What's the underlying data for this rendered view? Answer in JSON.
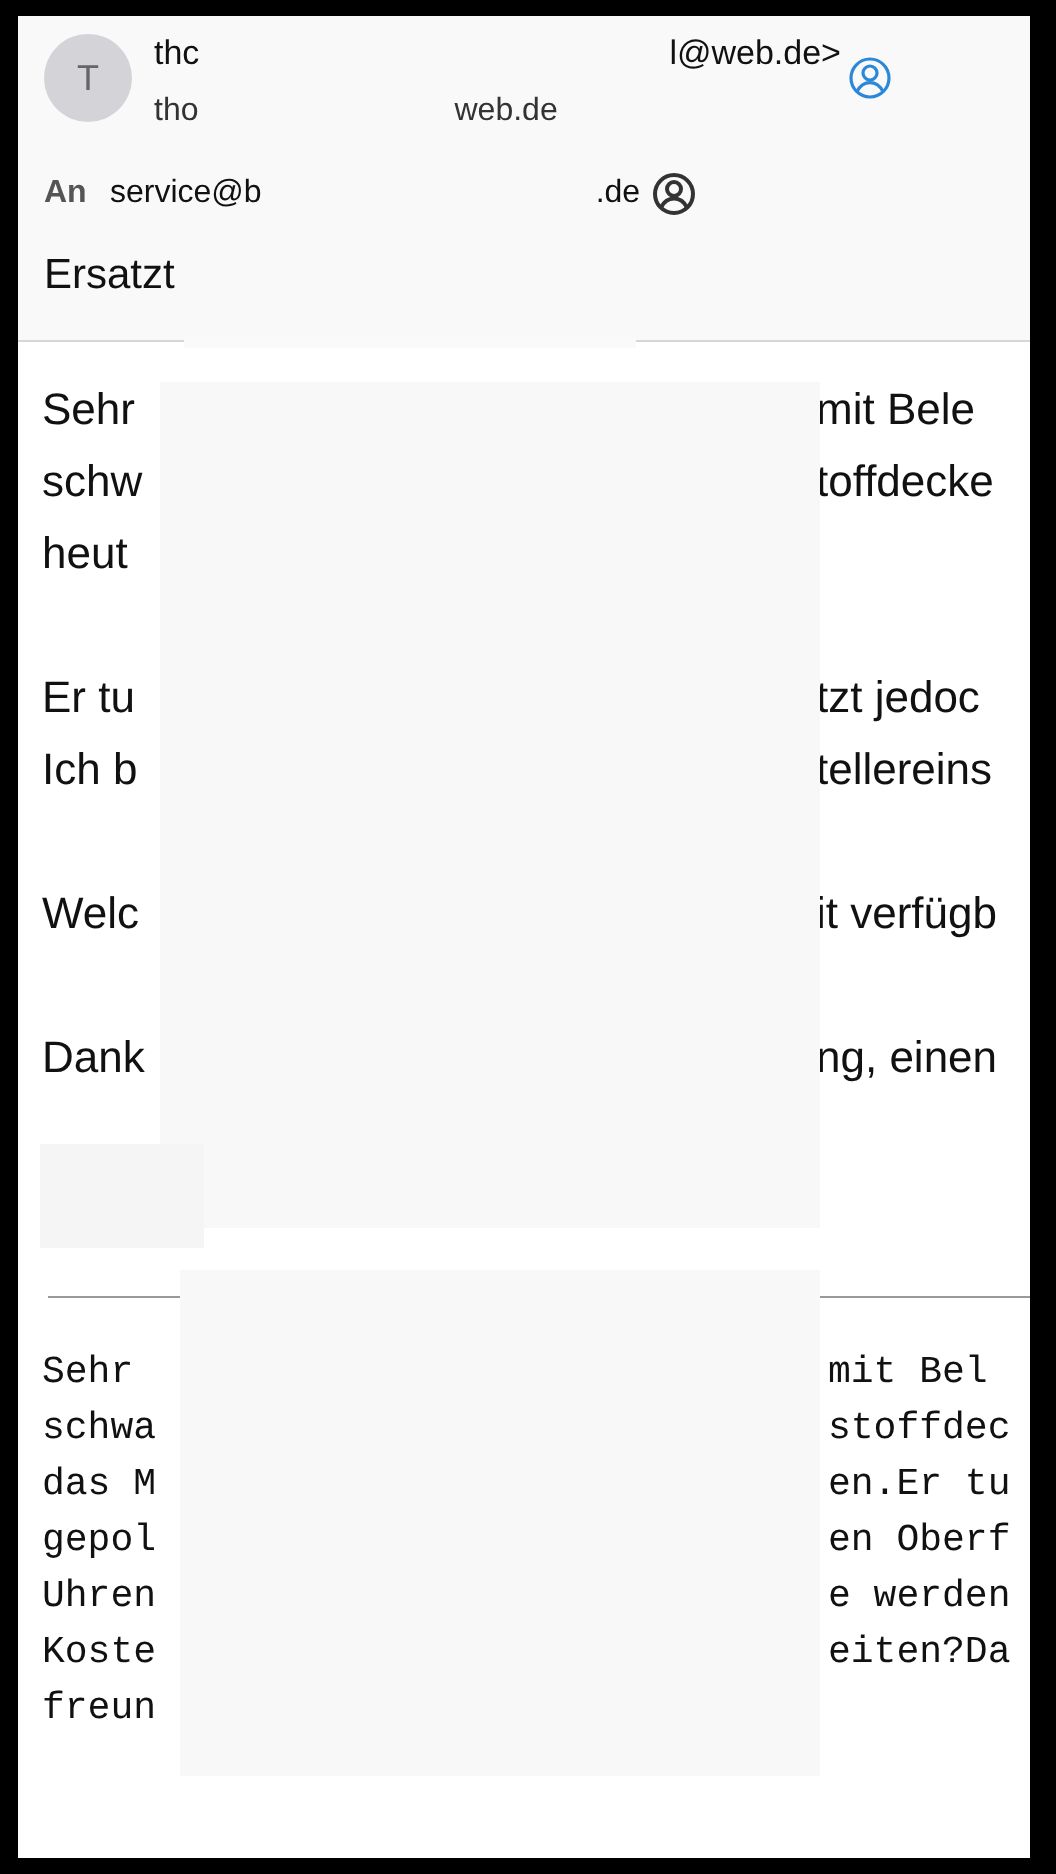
{
  "sender": {
    "avatar_initial": "T",
    "name_parts": [
      "thc",
      "l@web.de>"
    ],
    "address_parts": [
      "tho",
      "web.de"
    ]
  },
  "recipient": {
    "label": "An",
    "address_parts": [
      "service@b",
      ".de"
    ]
  },
  "subject": "Ersatzt",
  "body_formatted": {
    "paragraphs": [
      {
        "lines": [
          {
            "left": "Sehr",
            "right": "mit Bele"
          },
          {
            "left": "schw",
            "right": "toffdecke"
          },
          {
            "left": "heut"
          }
        ]
      },
      {
        "lines": [
          {
            "left": "Er tu",
            "right": "tzt jedoc"
          },
          {
            "left": "Ich b",
            "right": "tellereins"
          }
        ]
      },
      {
        "lines": [
          {
            "left": "Welc",
            "right": "it verfügb"
          }
        ]
      },
      {
        "lines": [
          {
            "left": "Dank",
            "right": "ng, einen"
          }
        ]
      }
    ]
  },
  "body_plain": {
    "lines": [
      {
        "left": "Sehr",
        "right": "mit Bel"
      },
      {
        "left": "schwa",
        "right": "stoffdec"
      },
      {
        "left": "das M",
        "right": "en.Er tu"
      },
      {
        "left": "gepol",
        "right": "en Oberf"
      },
      {
        "left": "Uhren",
        "right": "e werden"
      },
      {
        "left": "Koste",
        "right": "eiten?Da"
      },
      {
        "left": "freun"
      }
    ]
  }
}
